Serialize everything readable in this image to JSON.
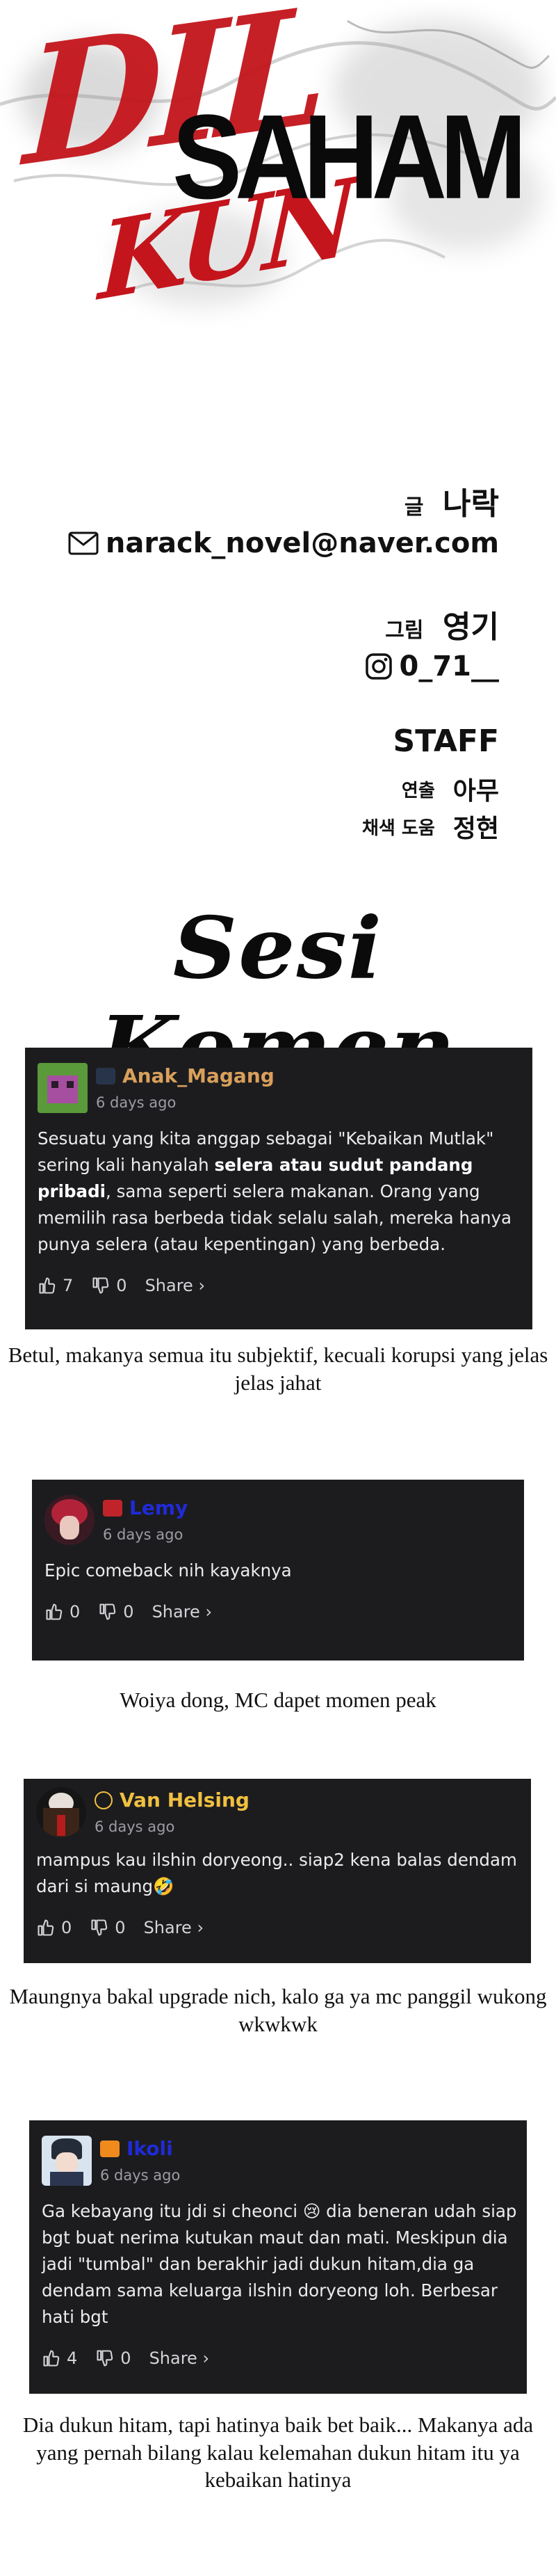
{
  "title": {
    "line1": "DIL",
    "line2": "SAHAM",
    "line3": "KUN",
    "colors": {
      "red": "#c4151c",
      "black": "#0a0a0a"
    }
  },
  "credits": {
    "writer_label": "글",
    "writer_name": "나락",
    "writer_email": "narack_novel@naver.com",
    "artist_label": "그림",
    "artist_name": "영기",
    "artist_handle": "0_71__",
    "staff_title": "STAFF",
    "director_label": "연출",
    "director_name": "아무",
    "color_label": "채색 도움",
    "color_name": "정현"
  },
  "section_title": "Sesi Komen",
  "comments": [
    {
      "username": "Anak_Magang",
      "username_color": "#d9a05b",
      "time": "6 days ago",
      "text_before": "Sesuatu yang kita anggap sebagai \"Kebaikan Mutlak\" sering kali hanyalah ",
      "text_bold": "selera atau sudut pandang pribadi",
      "text_after": ", sama seperti selera makanan. Orang yang memilih rasa berbeda tidak selalu salah, mereka hanya punya selera (atau kepentingan) yang berbeda.",
      "likes": "7",
      "dislikes": "0",
      "share": "Share ›"
    },
    {
      "username": "Lemy",
      "username_color": "#1f2bd8",
      "time": "6 days ago",
      "text": "Epic comeback nih kayaknya",
      "likes": "0",
      "dislikes": "0",
      "share": "Share ›"
    },
    {
      "username": "Van Helsing",
      "username_color": "#f0c040",
      "time": "6 days ago",
      "text": "mampus kau ilshin doryeong.. siap2 kena balas dendam dari si maung🤣",
      "likes": "0",
      "dislikes": "0",
      "share": "Share ›"
    },
    {
      "username": "Ikoli",
      "username_color": "#1f2bd8",
      "time": "6 days ago",
      "text": "Ga kebayang itu jdi si cheonci 😢 dia beneran udah siap bgt buat nerima kutukan maut dan mati. Meskipun dia jadi \"tumbal\" dan berakhir jadi dukun hitam,dia ga dendam sama keluarga ilshin doryeong loh. Berbesar hati bgt",
      "likes": "4",
      "dislikes": "0",
      "share": "Share ›"
    }
  ],
  "replies": [
    "Betul, makanya semua itu subjektif, kecuali korupsi yang jelas jelas jahat",
    "Woiya dong, MC dapet momen peak",
    "Maungnya bakal upgrade nich, kalo ga ya mc panggil wukong wkwkwk",
    "Dia dukun hitam, tapi hatinya baik bet baik... Makanya ada yang pernah bilang kalau kelemahan dukun hitam itu ya kebaikan hatinya"
  ],
  "icons": [
    "mail-icon",
    "instagram-icon",
    "thumbs-up-icon",
    "thumbs-down-icon"
  ]
}
